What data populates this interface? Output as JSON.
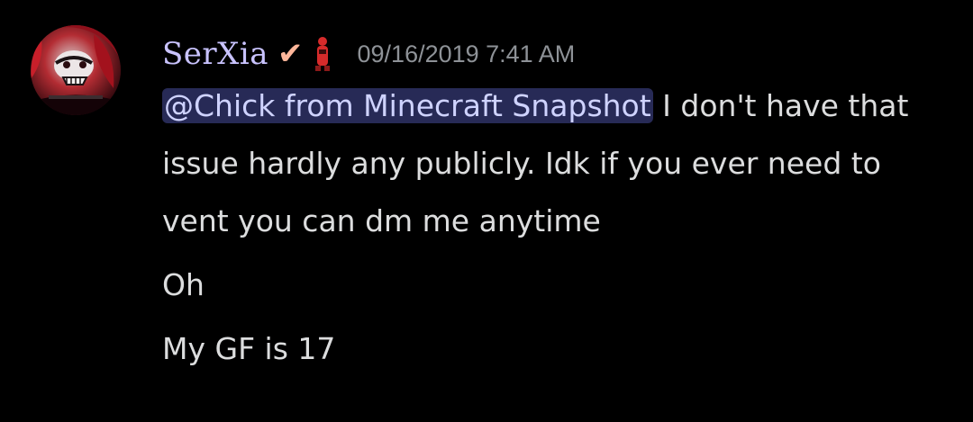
{
  "colors": {
    "background": "#000000",
    "username": "#c9c3ff",
    "timestamp": "#8e9297",
    "text": "#dcddde",
    "mention_bg": "#272a56",
    "mention_text": "#cfd3ff",
    "check": "#ffb69a",
    "badge": "#d62b2b"
  },
  "message": {
    "username": "SerXia",
    "verified_icon": "check-icon",
    "badge_icon": "red-doll-badge-icon",
    "timestamp": "09/16/2019 7:41 AM",
    "mention": "@Chick from Minecraft Snapshot",
    "first_text": " I don't have that issue hardly any publicly. Idk if you ever need to vent you can dm me anytime",
    "second_text": "Oh",
    "third_text": "My GF is 17"
  }
}
